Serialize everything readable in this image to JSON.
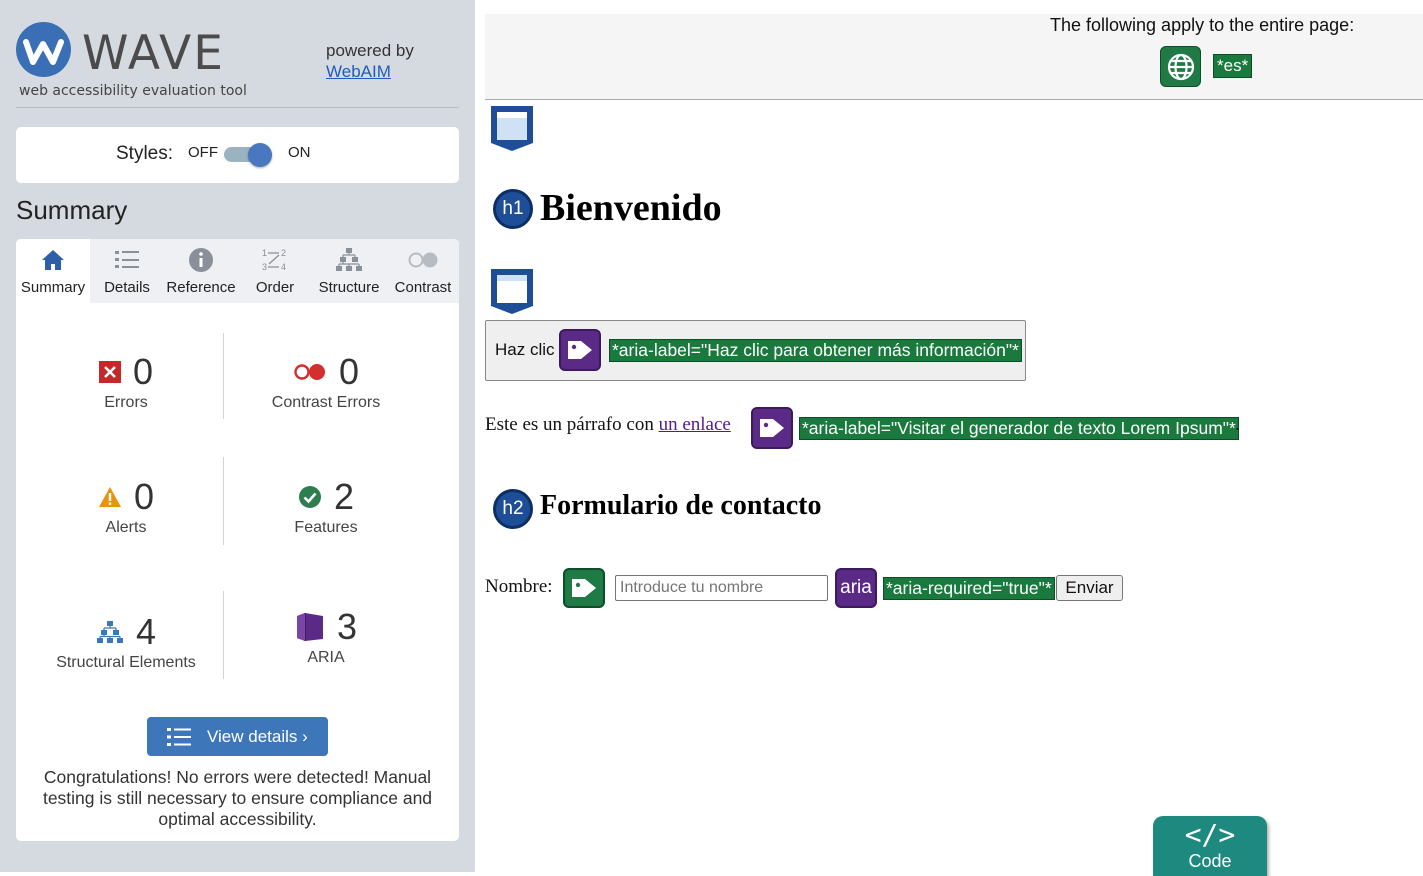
{
  "sidebar": {
    "logo_word": "WAVE",
    "logo_tagline": "web accessibility evaluation tool",
    "powered_by": "powered by",
    "powered_link": "WebAIM",
    "styles": {
      "label": "Styles:",
      "off": "OFF",
      "on": "ON",
      "state": "on"
    },
    "summary_title": "Summary",
    "tabs": [
      {
        "label": "Summary",
        "icon": "home-icon",
        "active": true
      },
      {
        "label": "Details",
        "icon": "list-icon",
        "active": false
      },
      {
        "label": "Reference",
        "icon": "info-icon",
        "active": false
      },
      {
        "label": "Order",
        "icon": "order-icon",
        "active": false
      },
      {
        "label": "Structure",
        "icon": "structure-icon",
        "active": false
      },
      {
        "label": "Contrast",
        "icon": "contrast-icon",
        "active": false
      }
    ],
    "stats": {
      "errors": {
        "count": "0",
        "label": "Errors"
      },
      "contrast_errors": {
        "count": "0",
        "label": "Contrast Errors"
      },
      "alerts": {
        "count": "0",
        "label": "Alerts"
      },
      "features": {
        "count": "2",
        "label": "Features"
      },
      "structural": {
        "count": "4",
        "label": "Structural Elements"
      },
      "aria": {
        "count": "3",
        "label": "ARIA"
      }
    },
    "view_details": "View details ›",
    "congrats": "Congratulations! No errors were detected! Manual testing is still necessary to ensure compliance and optimal accessibility."
  },
  "page": {
    "apply_text": "The following apply to the entire page:",
    "lang_note": "*es*",
    "h1": "Bienvenido",
    "h1_icon": "h1",
    "button_text": "Haz clic",
    "button_aria": "*aria-label=\"Haz clic para obtener más información\"*",
    "para_prefix": "Este es un párrafo con",
    "para_link": "un enlace",
    "para_aria": "*aria-label=\"Visitar el generador de texto Lorem Ipsum\"*",
    "para_suffix": ".",
    "h2": "Formulario de contacto",
    "h2_icon": "h2",
    "form_label": "Nombre:",
    "input_placeholder": "Introduce tu nombre",
    "aria_icon_label": "aria",
    "required_note": "*aria-required=\"true\"*",
    "submit": "Enviar",
    "code_label": "Code",
    "code_symbol": "</>"
  },
  "colors": {
    "accent_blue": "#3d77ba",
    "feature_green": "#1a7a3e",
    "aria_purple": "#5b2a86",
    "error_red": "#c62828",
    "code_teal": "#1e8a7f"
  }
}
